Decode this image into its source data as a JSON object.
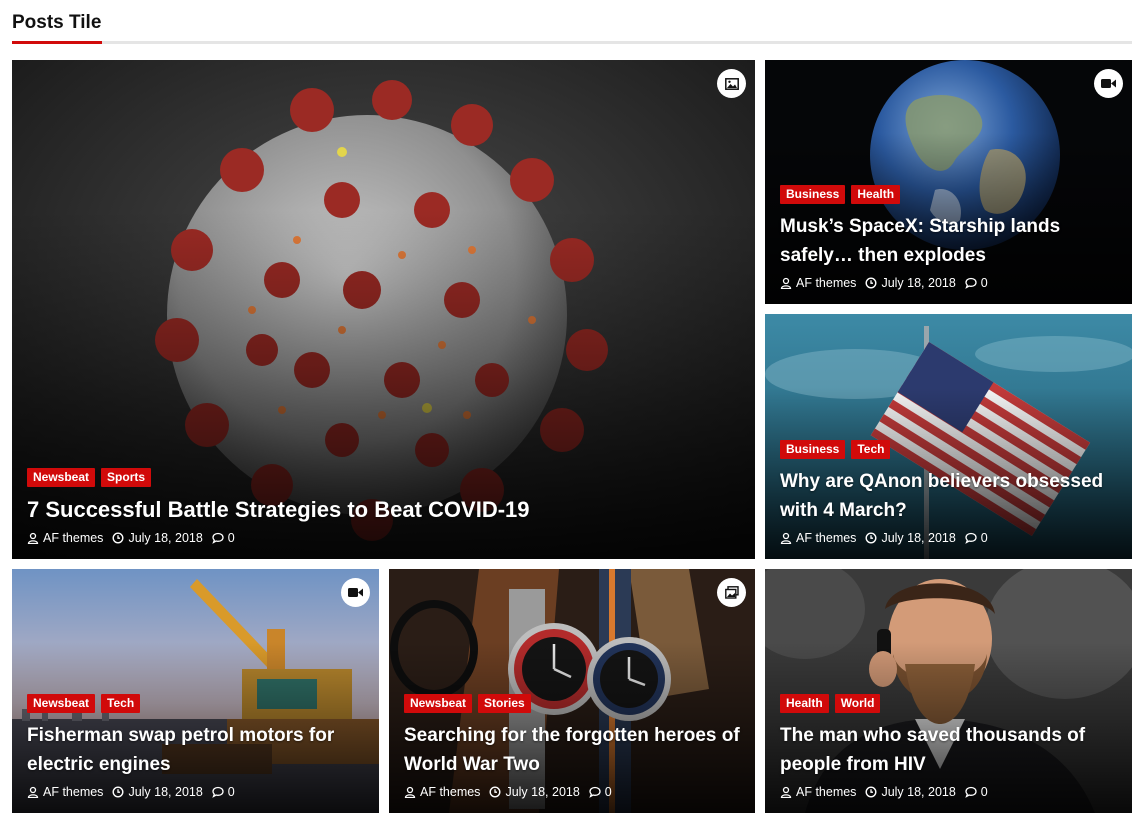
{
  "section": {
    "title": "Posts Tile"
  },
  "colors": {
    "accent": "#d10a0a",
    "category_bg": "#d10a0a"
  },
  "posts": [
    {
      "title": "7 Successful Battle Strategies to Beat COVID-19",
      "categories": [
        "Newsbeat",
        "Sports"
      ],
      "author": "AF themes",
      "date": "July 18, 2018",
      "comments": "0",
      "format_icon": "image-icon"
    },
    {
      "title": "Musk’s SpaceX: Starship lands safely… then explodes",
      "categories": [
        "Business",
        "Health"
      ],
      "author": "AF themes",
      "date": "July 18, 2018",
      "comments": "0",
      "format_icon": "video-icon"
    },
    {
      "title": "Why are QAnon believers obsessed with 4 March?",
      "categories": [
        "Business",
        "Tech"
      ],
      "author": "AF themes",
      "date": "July 18, 2018",
      "comments": "0",
      "format_icon": ""
    },
    {
      "title": "Fisherman swap petrol motors for electric engines",
      "categories": [
        "Newsbeat",
        "Tech"
      ],
      "author": "AF themes",
      "date": "July 18, 2018",
      "comments": "0",
      "format_icon": "video-icon"
    },
    {
      "title": "Searching for the forgotten heroes of World War Two",
      "categories": [
        "Newsbeat",
        "Stories"
      ],
      "author": "AF themes",
      "date": "July 18, 2018",
      "comments": "0",
      "format_icon": "gallery-icon"
    },
    {
      "title": "The man who saved thousands of people from HIV",
      "categories": [
        "Health",
        "World"
      ],
      "author": "AF themes",
      "date": "July 18, 2018",
      "comments": "0",
      "format_icon": ""
    }
  ]
}
